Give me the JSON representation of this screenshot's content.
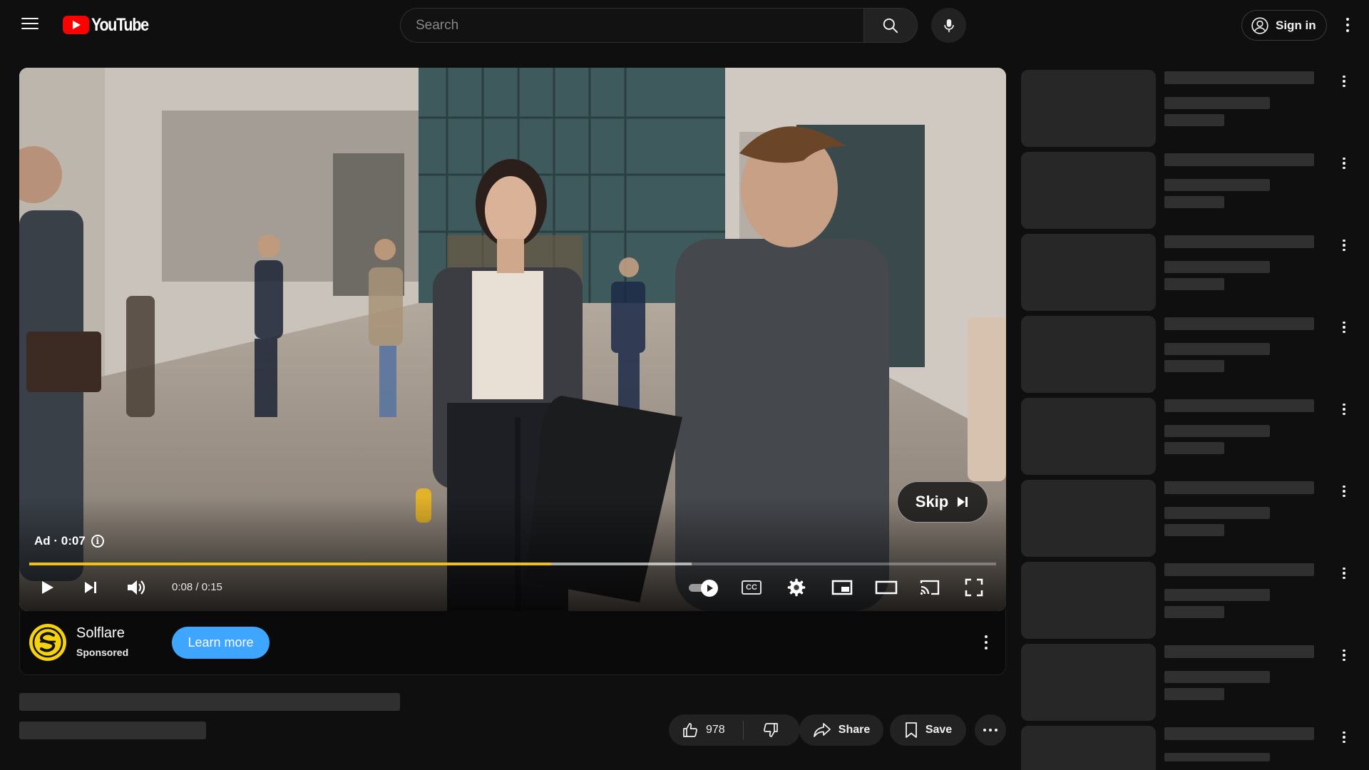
{
  "header": {
    "brand": "YouTube",
    "search_placeholder": "Search",
    "sign_in_label": "Sign in"
  },
  "player": {
    "ad_badge": "Ad · 0:07",
    "skip_label": "Skip",
    "time_display": "0:08 / 0:15",
    "progress_played_fraction": 0.54,
    "progress_buffered_fraction": 0.685,
    "autoplay_on": true
  },
  "ad": {
    "advertiser": "Solflare",
    "sponsored_label": "Sponsored",
    "cta_label": "Learn more",
    "logo_color": "#f5d20a"
  },
  "video_actions": {
    "like_count": "978",
    "share_label": "Share",
    "save_label": "Save"
  },
  "colors": {
    "accent_progress": "#f2c00f",
    "cta_blue": "#3ea6ff",
    "brand_red": "#ff0000"
  },
  "sidebar": {
    "recommendation_placeholders": 9
  },
  "icons": [
    "hamburger-menu-icon",
    "youtube-logo-icon",
    "search-icon",
    "microphone-icon",
    "account-circle-icon",
    "more-vert-icon",
    "info-icon",
    "skip-next-icon",
    "play-icon",
    "next-icon",
    "volume-icon",
    "autoplay-toggle-icon",
    "closed-captions-icon",
    "settings-gear-icon",
    "miniplayer-icon",
    "theater-mode-icon",
    "cast-icon",
    "fullscreen-icon",
    "thumbs-up-icon",
    "thumbs-down-icon",
    "share-arrow-icon",
    "bookmark-icon",
    "more-horiz-icon"
  ]
}
